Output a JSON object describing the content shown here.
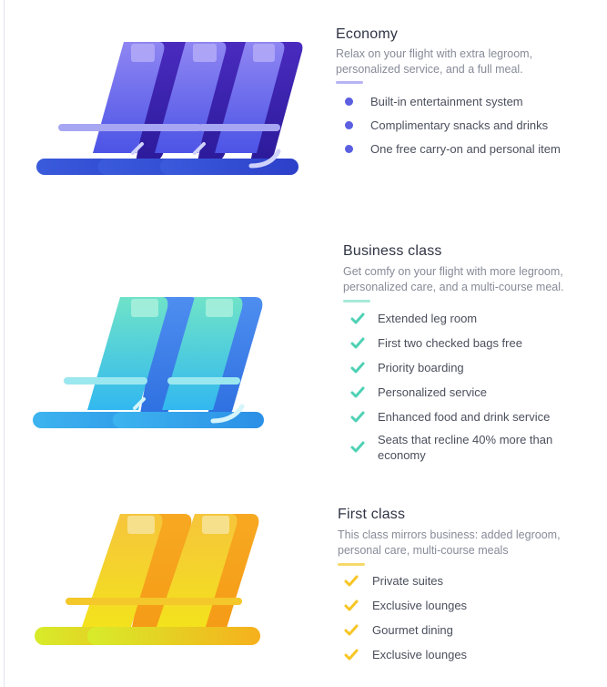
{
  "colors": {
    "economy_accent": "#5b5fe0",
    "business_accent": "#4fd1b5",
    "first_accent": "#f7c625"
  },
  "economy": {
    "title": "Economy",
    "description": "Relax on your flight with extra legroom, personalized service, and a full meal.",
    "features": [
      "Built-in entertainment system",
      "Complimentary snacks and drinks",
      "One free carry-on and personal item"
    ],
    "bullet_icon": "dot-icon",
    "seat_count": 3
  },
  "business": {
    "title": "Business class",
    "description": "Get comfy on your flight with more legroom, personalized care, and a multi-course meal.",
    "features": [
      "Extended leg room",
      "First two checked bags free",
      "Priority boarding",
      "Personalized service",
      "Enhanced food and drink service",
      "Seats that recline 40% more than economy"
    ],
    "bullet_icon": "check-icon",
    "seat_count": 2
  },
  "first": {
    "title": "First class",
    "description": "This class mirrors business: added legroom, personal care, multi-course meals",
    "features": [
      "Private suites",
      "Exclusive lounges",
      "Gourmet dining",
      "Exclusive lounges"
    ],
    "bullet_icon": "check-icon",
    "seat_count": 2
  }
}
